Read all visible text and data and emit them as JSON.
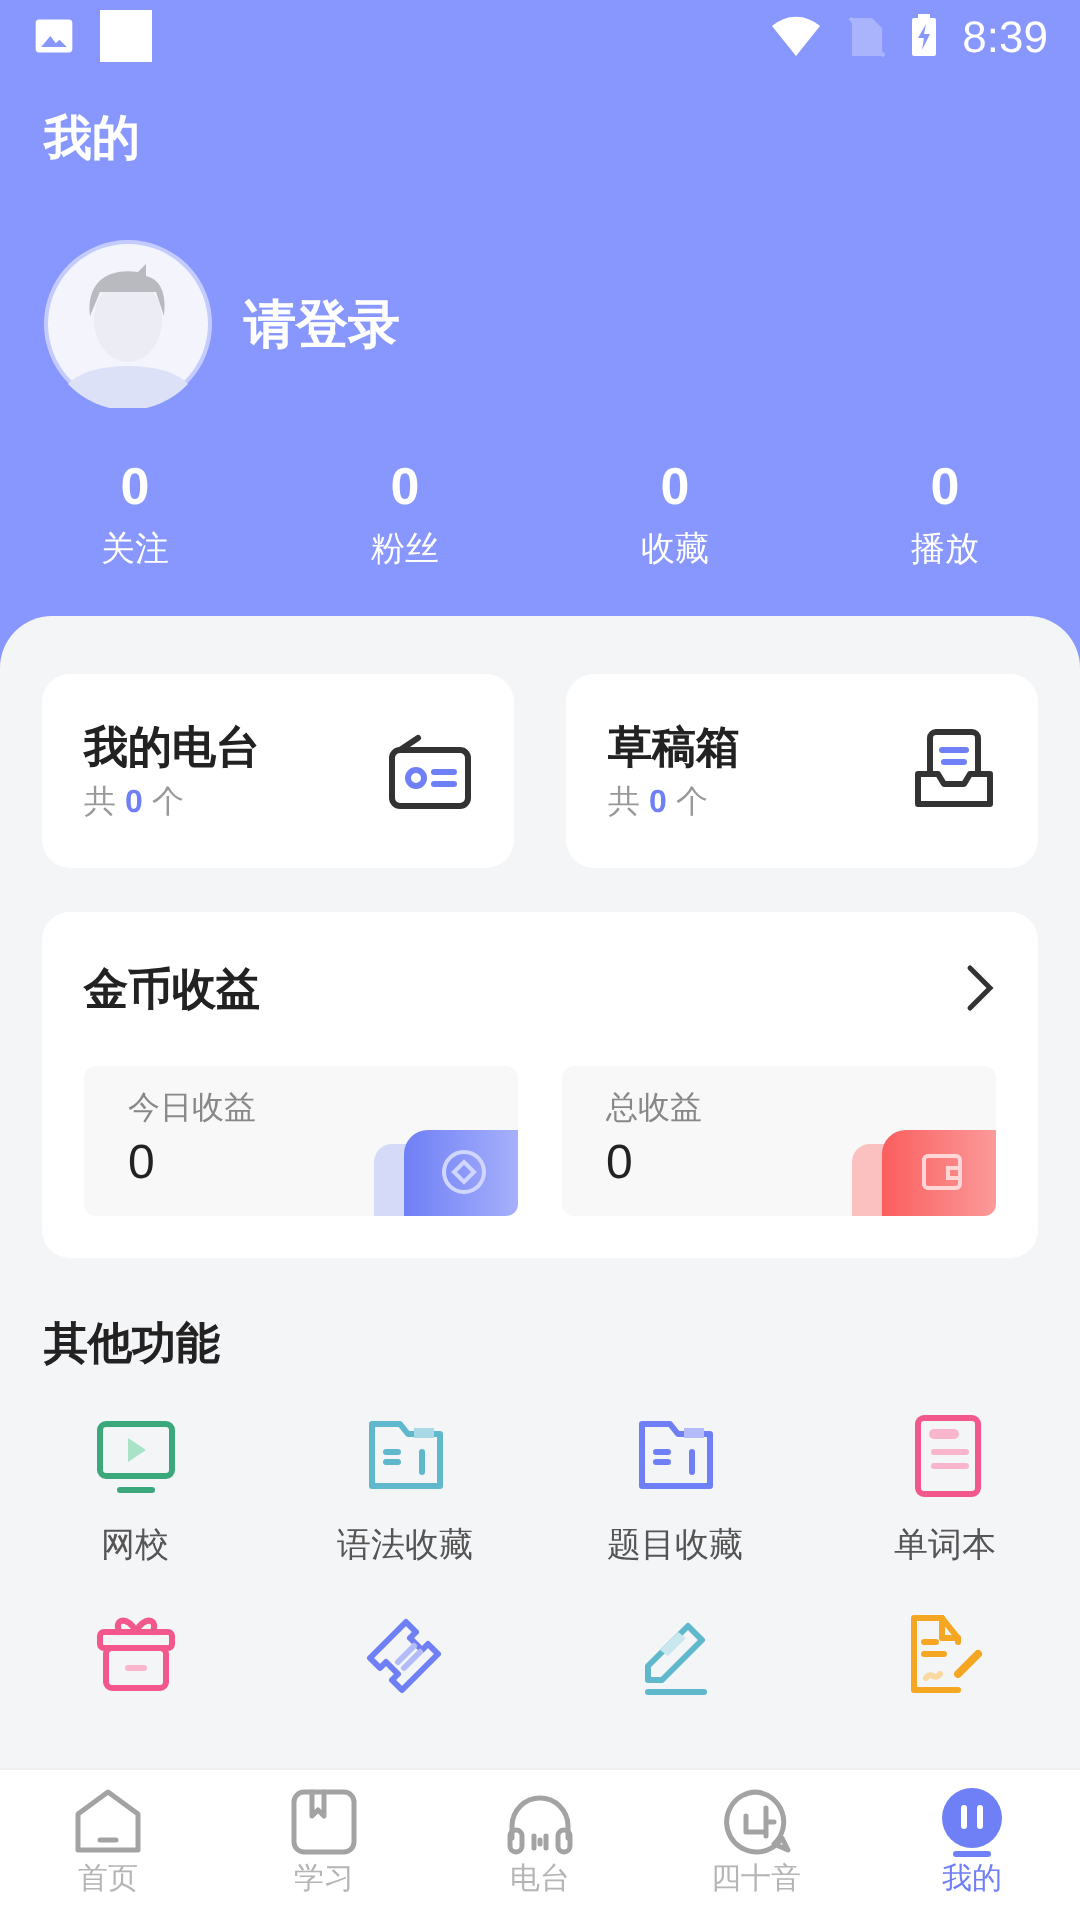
{
  "status_bar": {
    "time": "8:39"
  },
  "title": "我的",
  "profile": {
    "name": "请登录"
  },
  "stats": [
    {
      "value": "0",
      "label": "关注"
    },
    {
      "value": "0",
      "label": "粉丝"
    },
    {
      "value": "0",
      "label": "收藏"
    },
    {
      "value": "0",
      "label": "播放"
    }
  ],
  "cards": [
    {
      "title": "我的电台",
      "prefix": "共",
      "count": "0",
      "suffix": "个",
      "kind": "radio"
    },
    {
      "title": "草稿箱",
      "prefix": "共",
      "count": "0",
      "suffix": "个",
      "kind": "drafts"
    }
  ],
  "earnings": {
    "title": "金币收益",
    "items": [
      {
        "label": "今日收益",
        "value": "0",
        "kind": "coin"
      },
      {
        "label": "总收益",
        "value": "0",
        "kind": "wallet"
      }
    ]
  },
  "features": {
    "title": "其他功能",
    "items": [
      {
        "label": "网校",
        "kind": "tv"
      },
      {
        "label": "语法收藏",
        "kind": "grammar"
      },
      {
        "label": "题目收藏",
        "kind": "questions"
      },
      {
        "label": "单词本",
        "kind": "notebook"
      },
      {
        "kind": "gift"
      },
      {
        "kind": "ticket"
      },
      {
        "kind": "pencil"
      },
      {
        "kind": "document"
      }
    ]
  },
  "tab_bar": [
    {
      "label": "首页",
      "selected": false,
      "kind": "home"
    },
    {
      "label": "学习",
      "selected": false,
      "kind": "study"
    },
    {
      "label": "电台",
      "selected": false,
      "kind": "radio"
    },
    {
      "label": "四十音",
      "selected": false,
      "kind": "kana"
    },
    {
      "label": "我的",
      "selected": true,
      "kind": "me"
    }
  ]
}
